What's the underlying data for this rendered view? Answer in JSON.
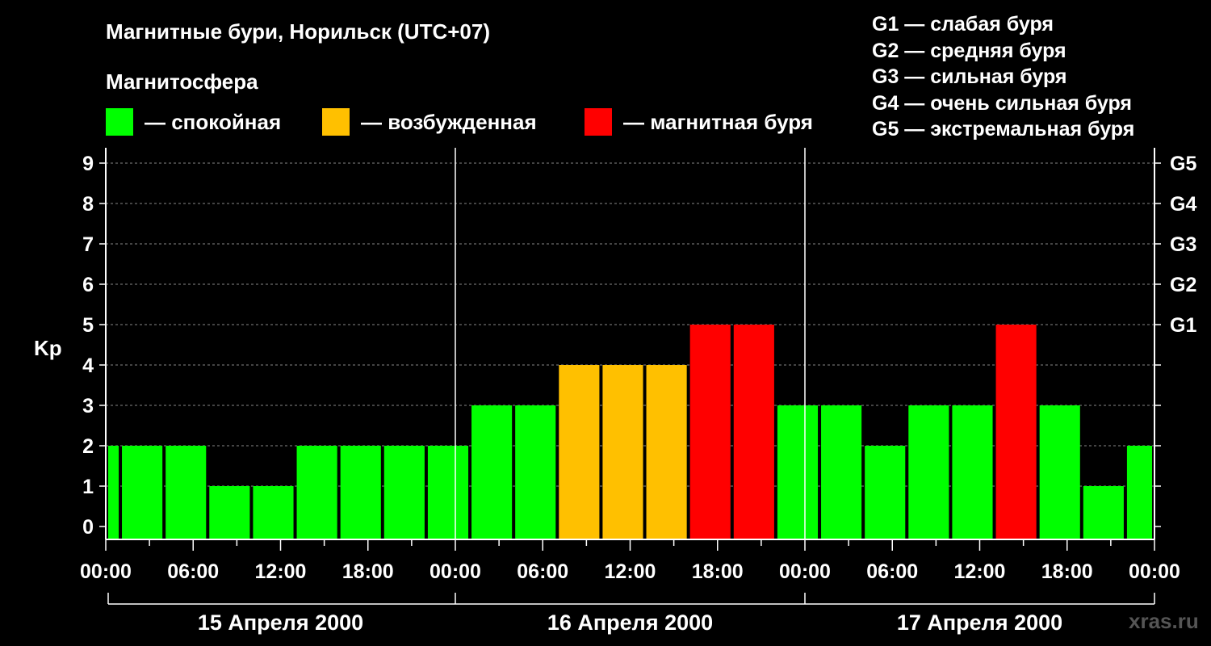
{
  "header": {
    "title": "Магнитные бури, Норильск (UTC+07)",
    "subtitle": "Магнитосфера"
  },
  "legend": [
    {
      "label": "— спокойная",
      "color": "#00ff00"
    },
    {
      "label": "— возбужденная",
      "color": "#ffc000"
    },
    {
      "label": "— магнитная буря",
      "color": "#ff0000"
    }
  ],
  "g_legend": [
    "G1 — слабая буря",
    "G2 — средняя буря",
    "G3 — сильная буря",
    "G4 — очень сильная буря",
    "G5 — экстремальная буря"
  ],
  "credit": "xras.ru",
  "chart_data": {
    "type": "bar",
    "ylabel": "Kp",
    "ylim": [
      0,
      9
    ],
    "yticks": [
      "0",
      "1",
      "2",
      "3",
      "4",
      "5",
      "6",
      "7",
      "8",
      "9"
    ],
    "g_scale_ticks": [
      {
        "kp": 5,
        "label": "G1"
      },
      {
        "kp": 6,
        "label": "G2"
      },
      {
        "kp": 7,
        "label": "G3"
      },
      {
        "kp": 8,
        "label": "G4"
      },
      {
        "kp": 9,
        "label": "G5"
      }
    ],
    "xticks": [
      "00:00",
      "06:00",
      "12:00",
      "18:00",
      "00:00",
      "06:00",
      "12:00",
      "18:00",
      "00:00",
      "06:00",
      "12:00",
      "18:00",
      "00:00"
    ],
    "days": [
      "15 Апреля 2000",
      "16 Апреля 2000",
      "17 Апреля 2000"
    ],
    "series": [
      {
        "values": [
          2,
          2,
          2,
          1,
          1,
          2,
          2,
          2,
          2,
          3,
          3,
          4,
          4,
          4,
          5,
          5,
          3,
          3,
          2,
          3,
          3,
          5,
          3,
          1,
          2
        ]
      }
    ],
    "grid": "dashed horizontal",
    "colors": {
      "quiet": "#00ff00",
      "active": "#ffc000",
      "storm": "#ff0000"
    }
  }
}
